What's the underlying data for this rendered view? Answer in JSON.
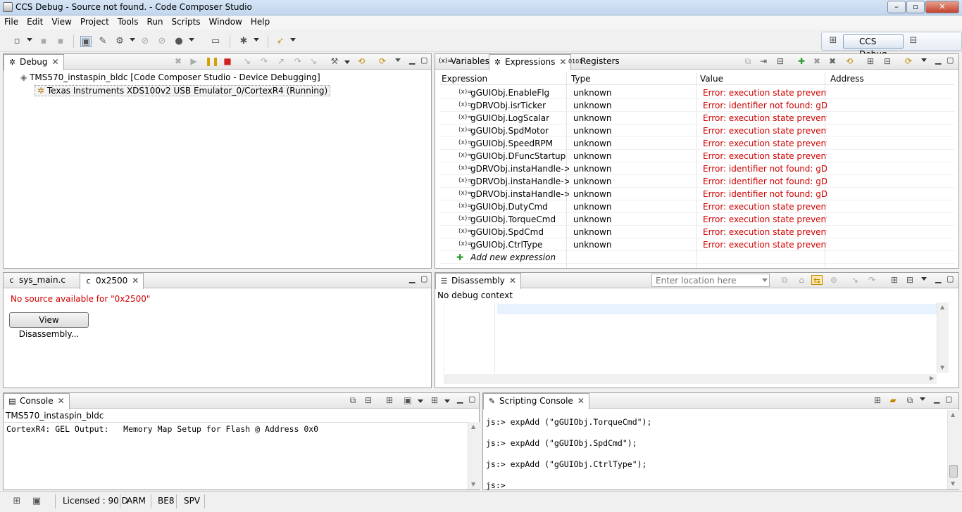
{
  "window": {
    "title": "CCS Debug - Source not found. - Code Composer Studio",
    "min": "–",
    "max": "▫",
    "close": "✕"
  },
  "menu": [
    "File",
    "Edit",
    "View",
    "Project",
    "Tools",
    "Run",
    "Scripts",
    "Window",
    "Help"
  ],
  "perspective": {
    "label": "CCS Debug"
  },
  "debug_view": {
    "tab": "Debug",
    "items": [
      {
        "label": "TMS570_instaspin_bldc [Code Composer Studio - Device Debugging]"
      },
      {
        "label": "Texas Instruments XDS100v2 USB Emulator_0/CortexR4 (Running)"
      }
    ]
  },
  "expressions_view": {
    "tabs": [
      "Variables",
      "Expressions",
      "Registers"
    ],
    "columns": [
      "Expression",
      "Type",
      "Value",
      "Address"
    ],
    "rows": [
      {
        "expr": "gGUIObj.EnableFlg",
        "type": "unknown",
        "value": "Error: execution state prevented..."
      },
      {
        "expr": "gDRVObj.isrTicker",
        "type": "unknown",
        "value": "Error: identifier not found: gDR..."
      },
      {
        "expr": "gGUIObj.LogScalar",
        "type": "unknown",
        "value": "Error: execution state prevented..."
      },
      {
        "expr": "gGUIObj.SpdMotor",
        "type": "unknown",
        "value": "Error: execution state prevented..."
      },
      {
        "expr": "gGUIObj.SpeedRPM",
        "type": "unknown",
        "value": "Error: execution state prevented..."
      },
      {
        "expr": "gGUIObj.DFuncStartup",
        "type": "unknown",
        "value": "Error: execution state prevented..."
      },
      {
        "expr": "gDRVObj.instaHandle->va",
        "type": "unknown",
        "value": "Error: identifier not found: gDR..."
      },
      {
        "expr": "gDRVObj.instaHandle->vb",
        "type": "unknown",
        "value": "Error: identifier not found: gDR..."
      },
      {
        "expr": "gDRVObj.instaHandle->vc",
        "type": "unknown",
        "value": "Error: identifier not found: gDR..."
      },
      {
        "expr": "gGUIObj.DutyCmd",
        "type": "unknown",
        "value": "Error: execution state prevented..."
      },
      {
        "expr": "gGUIObj.TorqueCmd",
        "type": "unknown",
        "value": "Error: execution state prevented..."
      },
      {
        "expr": "gGUIObj.SpdCmd",
        "type": "unknown",
        "value": "Error: execution state prevented..."
      },
      {
        "expr": "gGUIObj.CtrlType",
        "type": "unknown",
        "value": "Error: execution state prevented..."
      }
    ],
    "add_new": "Add new expression"
  },
  "editor": {
    "tabs": [
      "sys_main.c",
      "0x2500"
    ],
    "message": "No source available for \"0x2500\"",
    "button": "View Disassembly..."
  },
  "disassembly": {
    "tab": "Disassembly",
    "location_placeholder": "Enter location here",
    "context": "No debug context"
  },
  "console": {
    "tab": "Console",
    "project": "TMS570_instaspin_bldc",
    "line": "CortexR4: GEL Output:   Memory Map Setup for Flash @ Address 0x0"
  },
  "scripting": {
    "tab": "Scripting Console",
    "lines": [
      "js:> expAdd (\"gGUIObj.TorqueCmd\");",
      "js:> expAdd (\"gGUIObj.SpdCmd\");",
      "js:> expAdd (\"gGUIObj.CtrlType\");",
      "js:>"
    ]
  },
  "status": {
    "licensed": "Licensed : 90 D",
    "arch": "ARM",
    "endian": "BE8",
    "spv": "SPV"
  }
}
